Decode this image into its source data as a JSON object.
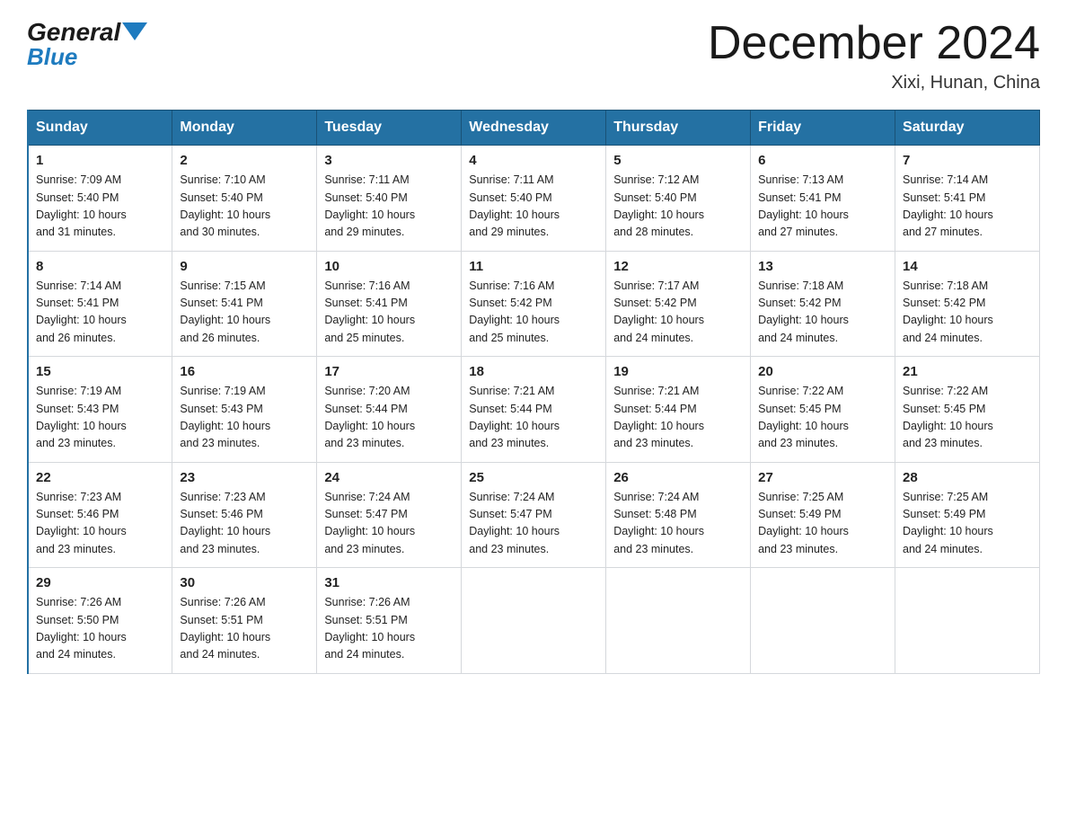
{
  "header": {
    "logo_general": "General",
    "logo_blue": "Blue",
    "title": "December 2024",
    "location": "Xixi, Hunan, China"
  },
  "days_of_week": [
    "Sunday",
    "Monday",
    "Tuesday",
    "Wednesday",
    "Thursday",
    "Friday",
    "Saturday"
  ],
  "weeks": [
    [
      {
        "day": "1",
        "sunrise": "7:09 AM",
        "sunset": "5:40 PM",
        "daylight": "10 hours and 31 minutes."
      },
      {
        "day": "2",
        "sunrise": "7:10 AM",
        "sunset": "5:40 PM",
        "daylight": "10 hours and 30 minutes."
      },
      {
        "day": "3",
        "sunrise": "7:11 AM",
        "sunset": "5:40 PM",
        "daylight": "10 hours and 29 minutes."
      },
      {
        "day": "4",
        "sunrise": "7:11 AM",
        "sunset": "5:40 PM",
        "daylight": "10 hours and 29 minutes."
      },
      {
        "day": "5",
        "sunrise": "7:12 AM",
        "sunset": "5:40 PM",
        "daylight": "10 hours and 28 minutes."
      },
      {
        "day": "6",
        "sunrise": "7:13 AM",
        "sunset": "5:41 PM",
        "daylight": "10 hours and 27 minutes."
      },
      {
        "day": "7",
        "sunrise": "7:14 AM",
        "sunset": "5:41 PM",
        "daylight": "10 hours and 27 minutes."
      }
    ],
    [
      {
        "day": "8",
        "sunrise": "7:14 AM",
        "sunset": "5:41 PM",
        "daylight": "10 hours and 26 minutes."
      },
      {
        "day": "9",
        "sunrise": "7:15 AM",
        "sunset": "5:41 PM",
        "daylight": "10 hours and 26 minutes."
      },
      {
        "day": "10",
        "sunrise": "7:16 AM",
        "sunset": "5:41 PM",
        "daylight": "10 hours and 25 minutes."
      },
      {
        "day": "11",
        "sunrise": "7:16 AM",
        "sunset": "5:42 PM",
        "daylight": "10 hours and 25 minutes."
      },
      {
        "day": "12",
        "sunrise": "7:17 AM",
        "sunset": "5:42 PM",
        "daylight": "10 hours and 24 minutes."
      },
      {
        "day": "13",
        "sunrise": "7:18 AM",
        "sunset": "5:42 PM",
        "daylight": "10 hours and 24 minutes."
      },
      {
        "day": "14",
        "sunrise": "7:18 AM",
        "sunset": "5:42 PM",
        "daylight": "10 hours and 24 minutes."
      }
    ],
    [
      {
        "day": "15",
        "sunrise": "7:19 AM",
        "sunset": "5:43 PM",
        "daylight": "10 hours and 23 minutes."
      },
      {
        "day": "16",
        "sunrise": "7:19 AM",
        "sunset": "5:43 PM",
        "daylight": "10 hours and 23 minutes."
      },
      {
        "day": "17",
        "sunrise": "7:20 AM",
        "sunset": "5:44 PM",
        "daylight": "10 hours and 23 minutes."
      },
      {
        "day": "18",
        "sunrise": "7:21 AM",
        "sunset": "5:44 PM",
        "daylight": "10 hours and 23 minutes."
      },
      {
        "day": "19",
        "sunrise": "7:21 AM",
        "sunset": "5:44 PM",
        "daylight": "10 hours and 23 minutes."
      },
      {
        "day": "20",
        "sunrise": "7:22 AM",
        "sunset": "5:45 PM",
        "daylight": "10 hours and 23 minutes."
      },
      {
        "day": "21",
        "sunrise": "7:22 AM",
        "sunset": "5:45 PM",
        "daylight": "10 hours and 23 minutes."
      }
    ],
    [
      {
        "day": "22",
        "sunrise": "7:23 AM",
        "sunset": "5:46 PM",
        "daylight": "10 hours and 23 minutes."
      },
      {
        "day": "23",
        "sunrise": "7:23 AM",
        "sunset": "5:46 PM",
        "daylight": "10 hours and 23 minutes."
      },
      {
        "day": "24",
        "sunrise": "7:24 AM",
        "sunset": "5:47 PM",
        "daylight": "10 hours and 23 minutes."
      },
      {
        "day": "25",
        "sunrise": "7:24 AM",
        "sunset": "5:47 PM",
        "daylight": "10 hours and 23 minutes."
      },
      {
        "day": "26",
        "sunrise": "7:24 AM",
        "sunset": "5:48 PM",
        "daylight": "10 hours and 23 minutes."
      },
      {
        "day": "27",
        "sunrise": "7:25 AM",
        "sunset": "5:49 PM",
        "daylight": "10 hours and 23 minutes."
      },
      {
        "day": "28",
        "sunrise": "7:25 AM",
        "sunset": "5:49 PM",
        "daylight": "10 hours and 24 minutes."
      }
    ],
    [
      {
        "day": "29",
        "sunrise": "7:26 AM",
        "sunset": "5:50 PM",
        "daylight": "10 hours and 24 minutes."
      },
      {
        "day": "30",
        "sunrise": "7:26 AM",
        "sunset": "5:51 PM",
        "daylight": "10 hours and 24 minutes."
      },
      {
        "day": "31",
        "sunrise": "7:26 AM",
        "sunset": "5:51 PM",
        "daylight": "10 hours and 24 minutes."
      },
      null,
      null,
      null,
      null
    ]
  ],
  "labels": {
    "sunrise": "Sunrise: ",
    "sunset": "Sunset: ",
    "daylight": "Daylight: "
  }
}
